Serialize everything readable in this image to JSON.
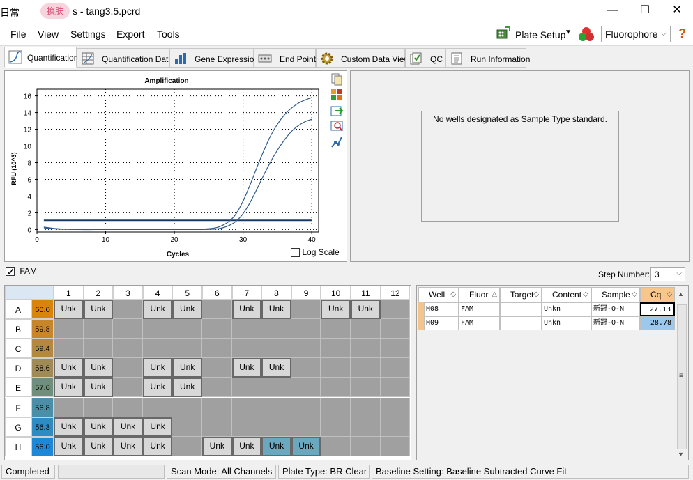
{
  "window": {
    "ime_text": "日常",
    "skin_button": "换肤",
    "title": "s - tang3.5.pcrd",
    "minimize": "—",
    "maximize": "☐",
    "close": "✕"
  },
  "menu": {
    "file": "File",
    "view": "View",
    "settings": "Settings",
    "export": "Export",
    "tools": "Tools"
  },
  "toolbar": {
    "plate_setup": "Plate Setup",
    "fluorophore": "Fluorophore",
    "help": "?"
  },
  "tabs": [
    "Quantification",
    "Quantification Data",
    "Gene Expression",
    "End Point",
    "Custom Data View",
    "QC",
    "Run Information"
  ],
  "chart_panel": {
    "log_scale_label": "Log Scale",
    "log_scale_checked": false
  },
  "chart_data": {
    "type": "line",
    "title": "Amplification",
    "xlabel": "Cycles",
    "ylabel": "RFU (10^3)",
    "xlim": [
      0,
      41
    ],
    "ylim": [
      -0.3,
      16.8
    ],
    "xticks": [
      0,
      10,
      20,
      30,
      40
    ],
    "yticks": [
      0,
      2,
      4,
      6,
      8,
      10,
      12,
      14,
      16
    ],
    "grid": true,
    "threshold": 1.1,
    "series": [
      {
        "x": [
          1,
          3,
          6,
          10,
          15,
          20,
          24,
          26,
          27,
          28,
          29,
          30,
          31,
          32,
          33,
          34,
          35,
          36,
          37,
          38,
          39,
          40
        ],
        "values": [
          0.3,
          0.1,
          0.0,
          0.0,
          0.0,
          0.0,
          0.05,
          0.2,
          0.5,
          1.0,
          1.9,
          3.4,
          5.3,
          7.4,
          9.4,
          11.2,
          12.6,
          13.7,
          14.5,
          15.1,
          15.5,
          15.8
        ]
      },
      {
        "x": [
          1,
          3,
          6,
          10,
          15,
          20,
          24,
          26,
          27,
          28,
          29,
          30,
          31,
          32,
          33,
          34,
          35,
          36,
          37,
          38,
          39,
          40
        ],
        "values": [
          0.2,
          0.05,
          0.0,
          0.0,
          0.0,
          0.0,
          0.0,
          0.05,
          0.2,
          0.5,
          1.0,
          1.9,
          3.2,
          4.8,
          6.5,
          8.1,
          9.5,
          10.7,
          11.7,
          12.4,
          12.9,
          13.2
        ]
      }
    ],
    "colors": {
      "curve": "#2d5a8a",
      "threshold": "#1a3a66"
    }
  },
  "sidebar_icons": [
    "copy-icon",
    "plate-color-icon",
    "export-chart-icon",
    "zoom-chart-icon",
    "curve-style-icon"
  ],
  "standard_curve": {
    "message": "No wells designated as Sample Type standard."
  },
  "fluor_filter": {
    "label": "FAM",
    "checked": true
  },
  "step": {
    "label": "Step Number:",
    "value": "3"
  },
  "plate": {
    "columns": [
      "1",
      "2",
      "3",
      "4",
      "5",
      "6",
      "7",
      "8",
      "9",
      "10",
      "11",
      "12"
    ],
    "rows": [
      {
        "letter": "A",
        "temp": "60.0",
        "color": "#d9850d",
        "unk": [
          1,
          2,
          4,
          5,
          7,
          8,
          10,
          11
        ]
      },
      {
        "letter": "B",
        "temp": "59.8",
        "color": "#c8862a",
        "unk": []
      },
      {
        "letter": "C",
        "temp": "59.4",
        "color": "#b5883f",
        "unk": []
      },
      {
        "letter": "D",
        "temp": "58.6",
        "color": "#a08a55",
        "unk": [
          1,
          2,
          4,
          5,
          7,
          8
        ]
      },
      {
        "letter": "E",
        "temp": "57.6",
        "color": "#6f8f7c",
        "unk": [
          1,
          2,
          4,
          5
        ]
      },
      {
        "letter": "F",
        "temp": "56.8",
        "color": "#4a8fa8",
        "unk": []
      },
      {
        "letter": "G",
        "temp": "56.3",
        "color": "#2d8cc4",
        "unk": [
          1,
          2,
          3,
          4
        ]
      },
      {
        "letter": "H",
        "temp": "56.0",
        "color": "#1d88d8",
        "unk": [
          1,
          2,
          3,
          4,
          6,
          7,
          8,
          9
        ]
      }
    ],
    "selected": [
      "H8",
      "H9"
    ],
    "unk_label": "Unk"
  },
  "results": {
    "headers": [
      "Well",
      "Fluor",
      "Target",
      "Content",
      "Sample",
      "Cq"
    ],
    "sort_arrows": [
      "◇",
      "△",
      "◇",
      "◇",
      "◇",
      "◇"
    ],
    "rows": [
      [
        "H08",
        "FAM",
        "",
        "Unkn",
        "新冠-O-N",
        "27.13"
      ],
      [
        "H09",
        "FAM",
        "",
        "Unkn",
        "新冠-O-N",
        "28.78"
      ]
    ]
  },
  "status": {
    "state": "Completed",
    "scan_mode": "Scan Mode: All Channels",
    "plate_type": "Plate Type: BR Clear",
    "baseline": "Baseline Setting: Baseline Subtracted Curve Fit"
  },
  "scroll": {
    "up": "▲",
    "down": "▼",
    "grip": "≡"
  }
}
